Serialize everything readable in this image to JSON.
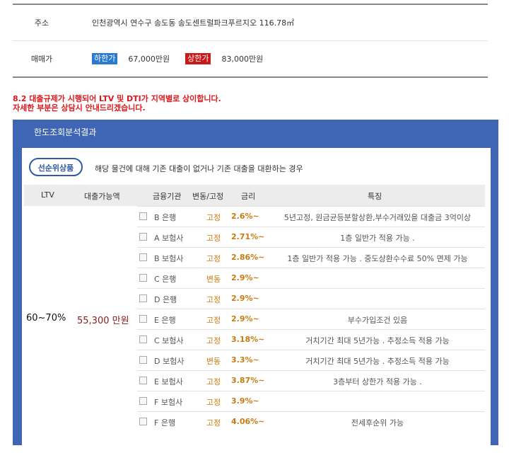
{
  "info": {
    "address_label": "주소",
    "address_value": "인천광역시 연수구 송도동 송도센트럴파크푸르지오 116.78㎡",
    "price_label": "매매가",
    "low_badge": "하한가",
    "low_price": "67,000만원",
    "high_badge": "상한가",
    "high_price": "83,000만원"
  },
  "notice": {
    "line1": "8.2 대출규제가 시행되어 LTV 및 DTI가 지역별로 상이합니다.",
    "line2": "자세한 부분은 상담시 안내드리겠습니다."
  },
  "panel": {
    "title": "한도조회분석결과",
    "pill_label": "선순위상품",
    "pill_desc": "해당 물건에 대해 기존 대출이 없거나 기존 대출을 대환하는 경우"
  },
  "table": {
    "headers": {
      "ltv": "LTV",
      "amount": "대출가능액",
      "institution": "금융기관",
      "type": "변동/고정",
      "rate": "금리",
      "feature": "특징"
    },
    "ltv": "60~70%",
    "amount": "55,300 만원",
    "rows": [
      {
        "institution": "B 은행",
        "type": "고정",
        "rate": "2.6%~",
        "feature": "5년고정, 원금균등분할상환,부수거래있을 대출금 3억이상"
      },
      {
        "institution": "A 보험사",
        "type": "고정",
        "rate": "2.71%~",
        "feature": "1층 일반가 적용 가능 ."
      },
      {
        "institution": "B 보험사",
        "type": "고정",
        "rate": "2.86%~",
        "feature": "1층 일반가 적용 가능 . 중도상환수수료 50% 면제 가능"
      },
      {
        "institution": "C 은행",
        "type": "변동",
        "rate": "2.9%~",
        "feature": ""
      },
      {
        "institution": "D 은행",
        "type": "고정",
        "rate": "2.9%~",
        "feature": ""
      },
      {
        "institution": "E 은행",
        "type": "고정",
        "rate": "2.9%~",
        "feature": "부수가입조건 있음"
      },
      {
        "institution": "C 보험사",
        "type": "고정",
        "rate": "3.18%~",
        "feature": "거치기간 최대 5년가능 . 추정소득 적용 가능"
      },
      {
        "institution": "D 보험사",
        "type": "변동",
        "rate": "3.3%~",
        "feature": "거치기간 최대 5년가능 . 추정소득 적용 가능"
      },
      {
        "institution": "E 보험사",
        "type": "고정",
        "rate": "3.87%~",
        "feature": "3층부터 상한가 적용 가능 ."
      },
      {
        "institution": "F 보험사",
        "type": "고정",
        "rate": "3.9%~",
        "feature": ""
      },
      {
        "institution": "F 은행",
        "type": "고정",
        "rate": "4.06%~",
        "feature": "전세후순위 가능"
      }
    ]
  }
}
